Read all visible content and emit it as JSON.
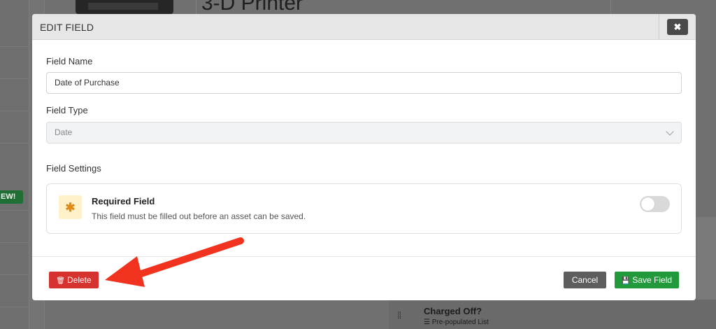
{
  "background": {
    "page_title": "3-D Printer",
    "badge": "EW!",
    "card": {
      "title": "Charged Off?",
      "icon": "list-icon",
      "subtitle": "Pre-populated List"
    }
  },
  "modal": {
    "title": "EDIT FIELD",
    "close_icon": "close-icon",
    "field_name": {
      "label": "Field Name",
      "value": "Date of Purchase"
    },
    "field_type": {
      "label": "Field Type",
      "value": "Date"
    },
    "settings": {
      "label": "Field Settings",
      "required": {
        "icon": "asterisk-icon",
        "title": "Required Field",
        "description": "This field must be filled out before an asset can be saved.",
        "enabled": false
      }
    },
    "footer": {
      "delete_label": "Delete",
      "delete_icon": "trash-icon",
      "cancel_label": "Cancel",
      "save_label": "Save Field",
      "save_icon": "floppy-disk-icon"
    }
  },
  "annotation": {
    "color": "#f0321e",
    "icon": "red-arrow-pointing-to-delete"
  }
}
